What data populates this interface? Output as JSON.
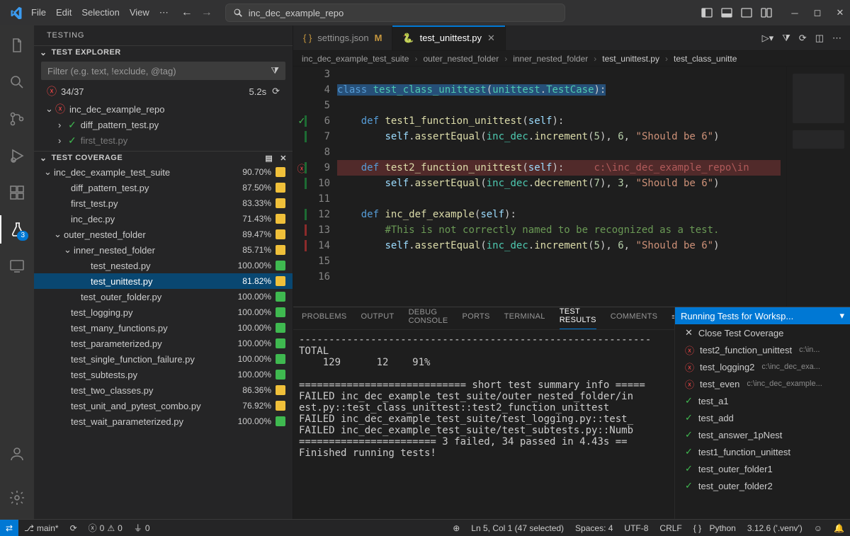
{
  "menu": {
    "file": "File",
    "edit": "Edit",
    "selection": "Selection",
    "view": "View"
  },
  "search_text": "inc_dec_example_repo",
  "sidebar": {
    "title": "TESTING",
    "explorer_header": "TEST EXPLORER",
    "filter_placeholder": "Filter (e.g. text, !exclude, @tag)",
    "status_count": "34/37",
    "status_time": "5.2s",
    "explorer_tree": [
      {
        "indent": 16,
        "chev": "⌄",
        "icon": "fail",
        "label": "inc_dec_example_repo"
      },
      {
        "indent": 34,
        "chev": "›",
        "icon": "pass",
        "label": "diff_pattern_test.py"
      },
      {
        "indent": 34,
        "chev": "›",
        "icon": "pass",
        "label": "first_test.py",
        "faded": true
      }
    ],
    "coverage_header": "TEST COVERAGE",
    "coverage_tree": [
      {
        "indent": 14,
        "chev": "⌄",
        "label": "inc_dec_example_test_suite",
        "pct": "90.70%",
        "bar": "yellow"
      },
      {
        "indent": 38,
        "label": "diff_pattern_test.py",
        "pct": "87.50%",
        "bar": "yellow"
      },
      {
        "indent": 38,
        "label": "first_test.py",
        "pct": "83.33%",
        "bar": "yellow"
      },
      {
        "indent": 38,
        "label": "inc_dec.py",
        "pct": "71.43%",
        "bar": "yellow"
      },
      {
        "indent": 28,
        "chev": "⌄",
        "label": "outer_nested_folder",
        "pct": "89.47%",
        "bar": "yellow"
      },
      {
        "indent": 42,
        "chev": "⌄",
        "label": "inner_nested_folder",
        "pct": "85.71%",
        "bar": "yellow"
      },
      {
        "indent": 66,
        "label": "test_nested.py",
        "pct": "100.00%",
        "bar": "green"
      },
      {
        "indent": 66,
        "label": "test_unittest.py",
        "pct": "81.82%",
        "bar": "yellow",
        "sel": true
      },
      {
        "indent": 52,
        "label": "test_outer_folder.py",
        "pct": "100.00%",
        "bar": "green"
      },
      {
        "indent": 38,
        "label": "test_logging.py",
        "pct": "100.00%",
        "bar": "green"
      },
      {
        "indent": 38,
        "label": "test_many_functions.py",
        "pct": "100.00%",
        "bar": "green"
      },
      {
        "indent": 38,
        "label": "test_parameterized.py",
        "pct": "100.00%",
        "bar": "green"
      },
      {
        "indent": 38,
        "label": "test_single_function_failure.py",
        "pct": "100.00%",
        "bar": "green"
      },
      {
        "indent": 38,
        "label": "test_subtests.py",
        "pct": "100.00%",
        "bar": "green"
      },
      {
        "indent": 38,
        "label": "test_two_classes.py",
        "pct": "86.36%",
        "bar": "yellow"
      },
      {
        "indent": 38,
        "label": "test_unit_and_pytest_combo.py",
        "pct": "76.92%",
        "bar": "yellow"
      },
      {
        "indent": 38,
        "label": "test_wait_parameterized.py",
        "pct": "100.00%",
        "bar": "green"
      }
    ]
  },
  "tabs": [
    {
      "icon": "braces",
      "label": "settings.json",
      "modified": true,
      "active": false
    },
    {
      "icon": "py",
      "label": "test_unittest.py",
      "modified": false,
      "active": true
    }
  ],
  "breadcrumbs": [
    "inc_dec_example_test_suite",
    "outer_nested_folder",
    "inner_nested_folder",
    "test_unittest.py",
    "test_class_unitte"
  ],
  "code_lines": [
    {
      "n": 3,
      "status": "",
      "cov": "",
      "html": ""
    },
    {
      "n": 4,
      "status": "",
      "cov": "",
      "html": "<span class='hl-sel'><span class='kw'>class</span> <span class='cls'>test_class_unittest</span>(<span class='cls'>unittest</span>.<span class='cls'>TestCase</span>):</span>"
    },
    {
      "n": 5,
      "status": "",
      "cov": "",
      "html": ""
    },
    {
      "n": 6,
      "status": "pass",
      "cov": "g",
      "html": "    <span class='kw'>def</span> <span class='fn'>test1_function_unittest</span>(<span class='self'>self</span>):"
    },
    {
      "n": 7,
      "status": "",
      "cov": "g",
      "html": "        <span class='self'>self</span>.<span class='fn'>assertEqual</span>(<span class='cls'>inc_dec</span>.<span class='fn'>increment</span>(<span class='num'>5</span>), <span class='num'>6</span>, <span class='str'>\"Should be 6\"</span>)"
    },
    {
      "n": 8,
      "status": "",
      "cov": "",
      "html": ""
    },
    {
      "n": 9,
      "status": "fail",
      "cov": "g",
      "html": "    <span class='kw'>def</span> <span class='fn'>test2_function_unittest</span>(<span class='self'>self</span>):     <span class='err-inline'>c:\\inc_dec_example_repo\\in</span>",
      "errline": true
    },
    {
      "n": 10,
      "status": "",
      "cov": "g",
      "html": "        <span class='self'>self</span>.<span class='fn'>assertEqual</span>(<span class='cls'>inc_dec</span>.<span class='fn'>decrement</span>(<span class='num'>7</span>), <span class='num'>3</span>, <span class='str'>\"Should be 6\"</span>)"
    },
    {
      "n": 11,
      "status": "",
      "cov": "",
      "html": ""
    },
    {
      "n": 12,
      "status": "",
      "cov": "g",
      "html": "    <span class='kw'>def</span> <span class='fn'>inc_def_example</span>(<span class='self'>self</span>):"
    },
    {
      "n": 13,
      "status": "",
      "cov": "r",
      "html": "        <span class='cmt'>#This is not correctly named to be recognized as a test.</span>"
    },
    {
      "n": 14,
      "status": "",
      "cov": "r",
      "html": "        <span class='self'>self</span>.<span class='fn'>assertEqual</span>(<span class='cls'>inc_dec</span>.<span class='fn'>increment</span>(<span class='num'>5</span>), <span class='num'>6</span>, <span class='str'>\"Should be 6\"</span>)"
    },
    {
      "n": 15,
      "status": "",
      "cov": "",
      "html": ""
    },
    {
      "n": 16,
      "status": "",
      "cov": "",
      "html": ""
    }
  ],
  "panel_tabs": [
    "PROBLEMS",
    "OUTPUT",
    "DEBUG CONSOLE",
    "PORTS",
    "TERMINAL",
    "TEST RESULTS",
    "COMMENTS"
  ],
  "panel_active": "TEST RESULTS",
  "terminal_lines": [
    "-----------------------------------------------------------",
    "TOTAL",
    "    129      12    91%",
    "",
    "============================ short test summary info =====",
    "FAILED inc_dec_example_test_suite/outer_nested_folder/in",
    "est.py::test_class_unittest::test2_function_unittest",
    "FAILED inc_dec_example_test_suite/test_logging.py::test_",
    "FAILED inc_dec_example_test_suite/test_subtests.py::Numb",
    "======================= 3 failed, 34 passed in 4.43s ==",
    "Finished running tests!"
  ],
  "panel_side": {
    "title": "Running Tests for Worksp...",
    "close": "Close Test Coverage",
    "items": [
      {
        "status": "fail",
        "label": "test2_function_unittest",
        "sub": "c:\\in..."
      },
      {
        "status": "fail",
        "label": "test_logging2",
        "sub": "c:\\inc_dec_exa..."
      },
      {
        "status": "fail",
        "label": "test_even",
        "sub": "c:\\inc_dec_example..."
      },
      {
        "status": "pass",
        "label": "test_a1",
        "sub": ""
      },
      {
        "status": "pass",
        "label": "test_add",
        "sub": ""
      },
      {
        "status": "pass",
        "label": "test_answer_1pNest",
        "sub": ""
      },
      {
        "status": "pass",
        "label": "test1_function_unittest",
        "sub": ""
      },
      {
        "status": "pass",
        "label": "test_outer_folder1",
        "sub": ""
      },
      {
        "status": "pass",
        "label": "test_outer_folder2",
        "sub": ""
      }
    ]
  },
  "statusbar": {
    "branch": "main*",
    "errors": "0",
    "warnings": "0",
    "radio": "0",
    "cursor": "Ln 5, Col 1 (47 selected)",
    "spaces": "Spaces: 4",
    "encoding": "UTF-8",
    "eol": "CRLF",
    "lang": "Python",
    "interp": "3.12.6 ('.venv')"
  },
  "activity_badge": "3"
}
